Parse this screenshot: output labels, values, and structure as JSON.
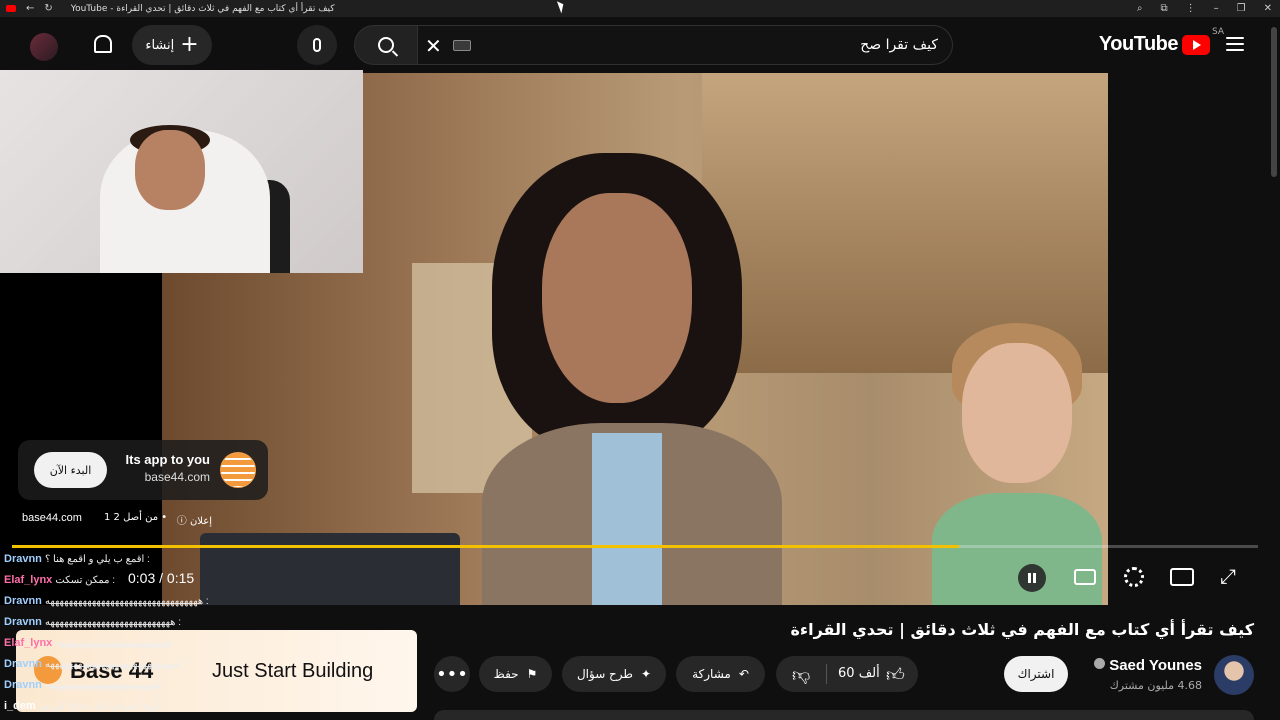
{
  "browser": {
    "tab_title": "YouTube - كيف تقرأ أي كتاب مع الفهم في ثلاث دقائق | تحدي القراءة",
    "nav_icons": [
      "back-icon",
      "reload-icon"
    ],
    "right_icons": [
      "zoom-icon",
      "extensions-icon",
      "more-icon",
      "minimize-icon",
      "maximize-icon",
      "close-icon"
    ]
  },
  "header": {
    "logo_text": "YouTube",
    "region": "SA",
    "search_value": "كيف تقرا صح",
    "create_label": "إنشاء",
    "create_icon": "plus-icon"
  },
  "player": {
    "ad_card": {
      "title": "Its app to you",
      "domain": "base44.com",
      "cta": "البدء الآن"
    },
    "ad_info": {
      "domain": "base44.com",
      "count": "1 من أصل 2 •",
      "label": "إعلان"
    },
    "progress_fraction": 0.76,
    "progress_color": "#f2c200",
    "time": "0:03 / 0:15"
  },
  "chat": [
    {
      "user": "Dravnn",
      "text": "اقمع ب يلي و اقمع هنا ؟ :",
      "color": "#9fd0ff"
    },
    {
      "user": "Elaf_lynx",
      "text": "ممكن تسكت :",
      "color": "#ff6fa8"
    },
    {
      "user": "Dravnn",
      "text": "هههههههههههههههههههههههههههههههههه :",
      "color": "#9fd0ff"
    },
    {
      "user": "Dravnn",
      "text": "هههههههههههههههههههههههههههه :",
      "color": "#9fd0ff"
    },
    {
      "user": "Elaf_lynx",
      "text": "ههههههههههههههههههههههههه :",
      "color": "#ff6fa8"
    },
    {
      "user": "Dravnn",
      "text": "ههههههههههههههههههههههههههههه :",
      "color": "#9fd0ff"
    },
    {
      "user": "Dravnn",
      "text": "ههههههههههههههههههههههههه :",
      "color": "#9fd0ff"
    },
    {
      "user": "i_dem",
      "text": "ايوه اعتراف انك تحتاج كورس :",
      "color": "#ffffff"
    }
  ],
  "stream_banner": {
    "brand": "Base 44",
    "tagline": "Just Start Building"
  },
  "video": {
    "title": "كيف تقرأ أي كتاب مع الفهم في ثلاث دقائق | تحدي القراءة",
    "channel": "Saed Younes",
    "subscribers": "4.68 مليون مشترك",
    "subscribe_label": "اشتراك",
    "likes": "60 ألف",
    "share_label": "مشاركة",
    "ask_label": "طرح سؤال",
    "save_label": "حفظ"
  }
}
